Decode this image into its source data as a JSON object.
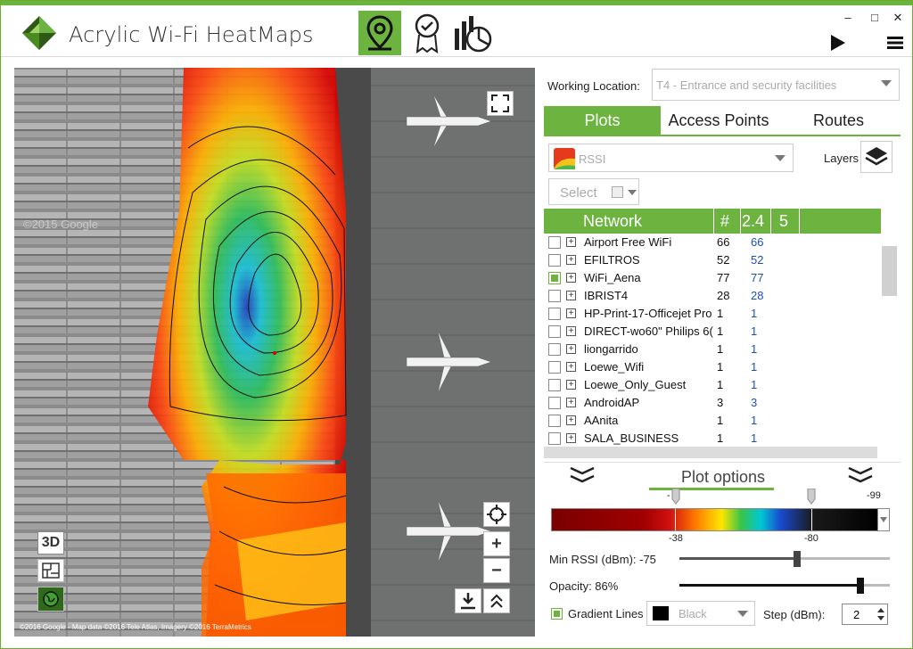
{
  "app": {
    "title": "Acrylic Wi-Fi HeatMaps"
  },
  "toolbar": {
    "modes": [
      {
        "name": "map-pin-icon",
        "active": true
      },
      {
        "name": "award-icon",
        "active": false
      },
      {
        "name": "chart-icon",
        "active": false
      }
    ],
    "play_icon": "play-icon",
    "menu_icon": "hamburger-icon"
  },
  "window_controls": {
    "minimize": "–",
    "maximize": "□",
    "close": "✕"
  },
  "map": {
    "credit": "©2016 Google - Map data ©2016 Tele Atlas, Imagery ©2016 TerraMetrics",
    "watermark": "©2015 Google",
    "btn_3d": "3D",
    "zoom_in": "+",
    "zoom_out": "−"
  },
  "panel": {
    "working_location_label": "Working Location:",
    "working_location_value": "T4 - Entrance and security facilities",
    "tabs": [
      {
        "label": "Plots",
        "active": true
      },
      {
        "label": "Access Points",
        "active": false
      },
      {
        "label": "Routes",
        "active": false
      }
    ],
    "plot_type": "RSSI",
    "layers_label": "Layers",
    "select_label": "Select",
    "network_header": {
      "network": "Network",
      "count": "#",
      "band24": "2.4",
      "band5": "5"
    },
    "networks": [
      {
        "name": "Airport Free WiFi",
        "count": "66",
        "band24": "66",
        "checked": false
      },
      {
        "name": "EFILTROS",
        "count": "52",
        "band24": "52",
        "checked": false
      },
      {
        "name": "WiFi_Aena",
        "count": "77",
        "band24": "77",
        "checked": true
      },
      {
        "name": "IBRIST4",
        "count": "28",
        "band24": "28",
        "checked": false
      },
      {
        "name": "HP-Print-17-Officejet Pro",
        "count": "1",
        "band24": "1",
        "checked": false
      },
      {
        "name": "DIRECT-wo60\" Philips 6(",
        "count": "1",
        "band24": "1",
        "checked": false
      },
      {
        "name": "liongarrido",
        "count": "1",
        "band24": "1",
        "checked": false
      },
      {
        "name": "Loewe_Wifi",
        "count": "1",
        "band24": "1",
        "checked": false
      },
      {
        "name": "Loewe_Only_Guest",
        "count": "1",
        "band24": "1",
        "checked": false
      },
      {
        "name": "AndroidAP",
        "count": "3",
        "band24": "3",
        "checked": false
      },
      {
        "name": "AAnita",
        "count": "1",
        "band24": "1",
        "checked": false
      },
      {
        "name": "SALA_BUSINESS",
        "count": "1",
        "band24": "1",
        "checked": false
      }
    ],
    "plot_options": {
      "title": "Plot options",
      "gradient_ticks": {
        "min_top": "-",
        "max_top": "-99",
        "left_bottom": "-38",
        "right_bottom": "-80"
      },
      "min_rssi_label": "Min RSSI (dBm): -75",
      "min_rssi_value": 0.56,
      "opacity_label": "Opacity: 86%",
      "opacity_value": 0.86,
      "gradient_lines_label": "Gradient Lines",
      "line_color": "Black",
      "step_label": "Step (dBm):",
      "step_value": "2"
    }
  },
  "colors": {
    "accent": "#6db33f",
    "link": "#1a4fb8"
  }
}
